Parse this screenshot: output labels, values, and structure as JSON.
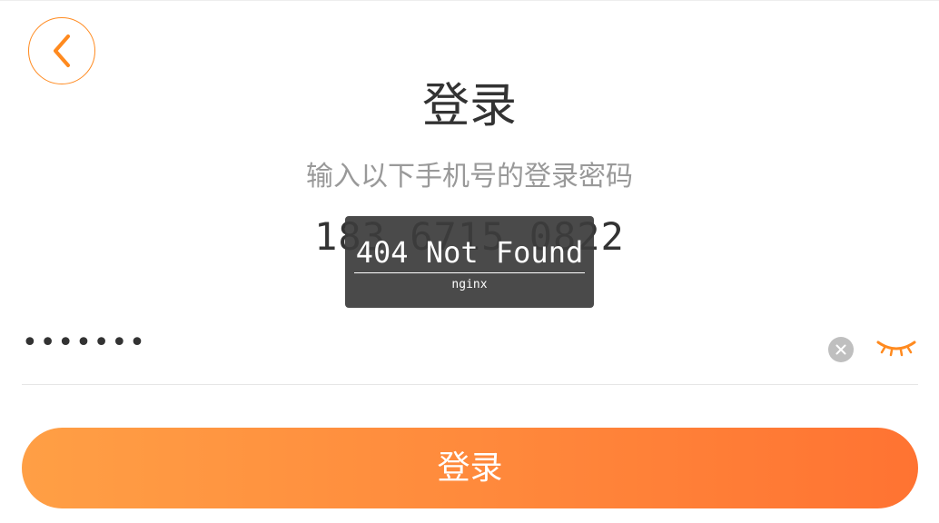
{
  "header": {
    "back_icon": "chevron-left-icon",
    "title": "登录"
  },
  "prompt": {
    "subtitle": "输入以下手机号的登录密码",
    "phone": "183 6715 0822"
  },
  "error_overlay": {
    "title": "404 Not Found",
    "server": "nginx"
  },
  "password": {
    "value": "•••••••",
    "clear_icon": "clear-icon",
    "toggle_icon": "eye-closed-icon"
  },
  "actions": {
    "login_label": "登录"
  },
  "colors": {
    "accent": "#ff8a1f",
    "button_gradient_start": "#ff9f45",
    "button_gradient_end": "#ff7332",
    "title_text": "#333333",
    "subtitle_text": "#999999"
  }
}
